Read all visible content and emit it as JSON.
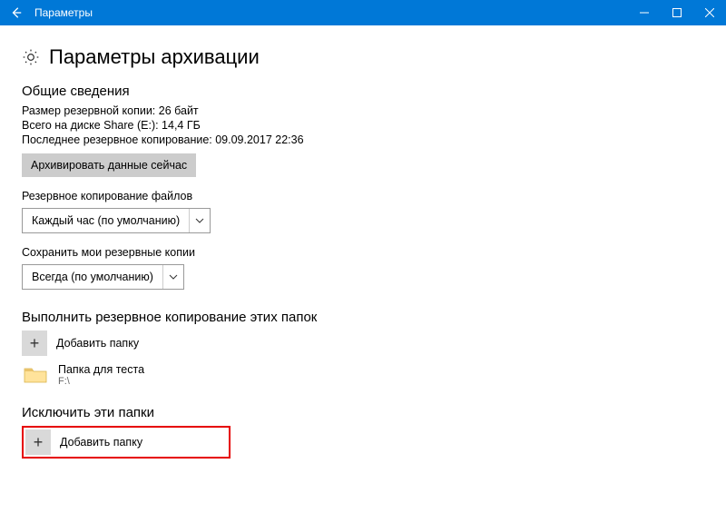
{
  "window": {
    "title": "Параметры"
  },
  "page": {
    "heading": "Параметры архивации"
  },
  "overview": {
    "heading": "Общие сведения",
    "size_line": "Размер резервной копии: 26 байт",
    "disk_line": "Всего на диске Share (E:): 14,4 ГБ",
    "last_backup_line": "Последнее резервное копирование: 09.09.2017 22:36",
    "backup_now_button": "Архивировать данные сейчас"
  },
  "frequency": {
    "label": "Резервное копирование файлов",
    "selected": "Каждый час (по умолчанию)"
  },
  "retention": {
    "label": "Сохранить мои резервные копии",
    "selected": "Всегда (по умолчанию)"
  },
  "include": {
    "heading": "Выполнить резервное копирование этих папок",
    "add_label": "Добавить папку",
    "folder": {
      "name": "Папка для теста",
      "path": "F:\\"
    }
  },
  "exclude": {
    "heading": "Исключить эти папки",
    "add_label": "Добавить папку"
  }
}
